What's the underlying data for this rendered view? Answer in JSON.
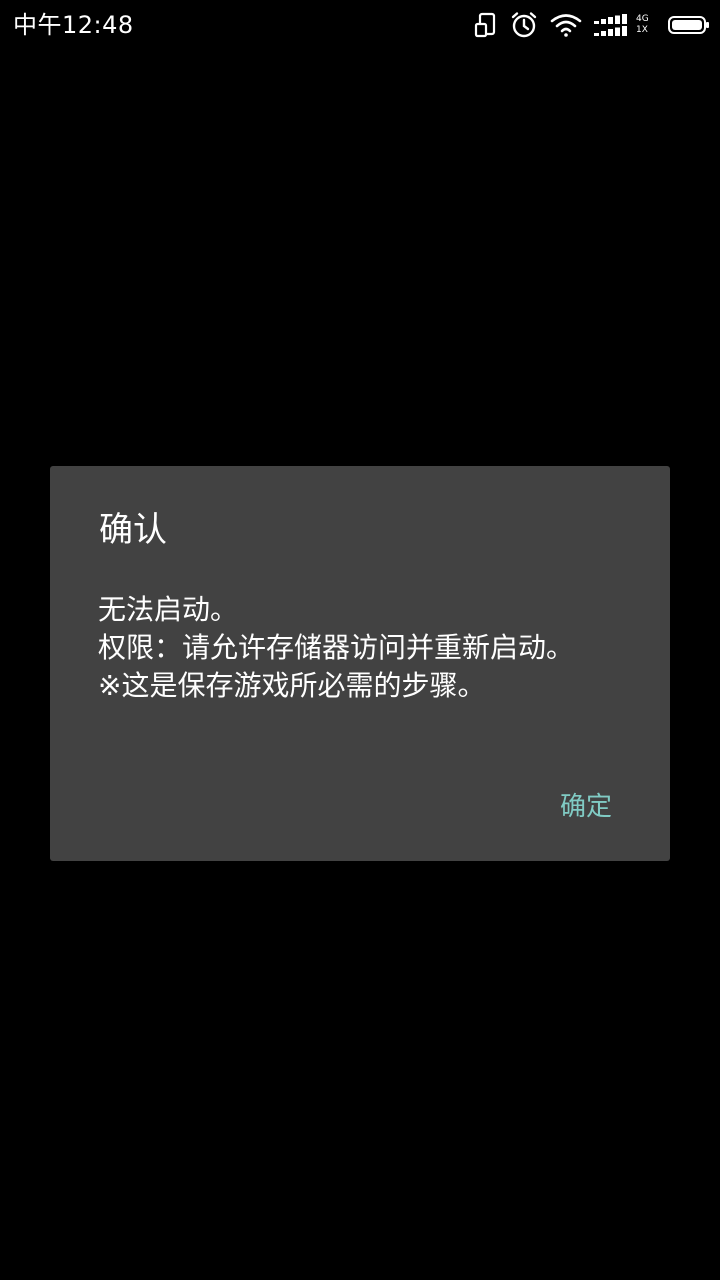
{
  "status_bar": {
    "time": "中午12:48",
    "network_type_top": "4G",
    "network_type_bottom": "1X",
    "icons": [
      "screen-rotation-icon",
      "alarm-clock-icon",
      "wifi-icon",
      "signal-strength-icon",
      "battery-icon"
    ]
  },
  "dialog": {
    "title": "确认",
    "message": "无法启动。\n权限：请允许存储器访问并重新启动。\n※这是保存游戏所必需的步骤。",
    "confirm_label": "确定",
    "accent_color": "#80CBC4",
    "background_color": "#424242"
  }
}
